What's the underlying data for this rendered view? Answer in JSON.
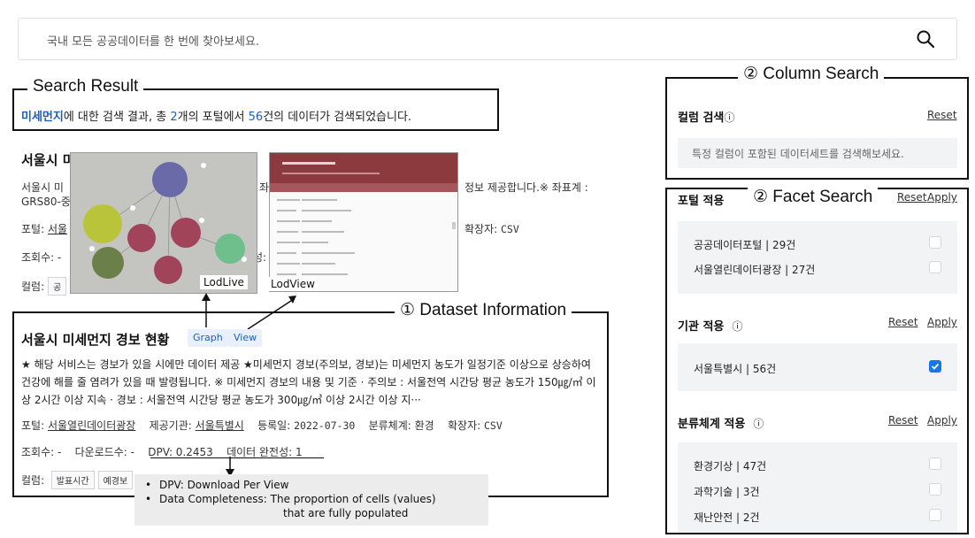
{
  "search": {
    "placeholder": "국내 모든 공공데이터를 한 번에 찾아보세요.",
    "icon": "search-icon"
  },
  "annotations": {
    "search_result": "Search Result",
    "column_search": "② Column Search",
    "facet_search": "② Facet Search",
    "dataset_information": "① Dataset Information",
    "lodlive": "LodLive",
    "lodview": "LodView",
    "tooltip": {
      "line1": "DPV: Download Per View",
      "line2a": "Data Completeness: The proportion of cells (values)",
      "line2b": "that are fully populated"
    }
  },
  "result_summary": {
    "keyword": "미세먼지",
    "part1": "에 대한 검색 결과, 총 ",
    "portal_count": "2",
    "part2": "개의 포털에서 ",
    "data_count": "56",
    "part3": "건의 데이터가 검색되었습니다."
  },
  "dataset1": {
    "title": "서울시 미",
    "desc_start": "서울시 미",
    "desc_start2": "GRS80-중",
    "desc_right": "좌",
    "desc_right2": "정보 제공합니다.※ 좌표계 :",
    "portal_label": "포털: ",
    "portal_value": "서울",
    "ext_label": "확장자: ",
    "ext_value": "CSV",
    "views_label": "조회수: -",
    "views_right": "성:",
    "columns_label": "컬럼:",
    "col_partial": "공"
  },
  "dataset2": {
    "title": "서울시 미세먼지 경보 현황",
    "tag_graph": "Graph",
    "tag_view": "View",
    "desc1": "★ 해당 서비스는 경보가 있을 시에만 데이터 제공 ★미세먼지 경보(주의보, 경보)는 미세먼지 농도가 일정기준 이상으로 상승하여",
    "desc2": "건강에 해를 줄 염려가 있을 때 발령됩니다. ※ 미세먼지 경보의 내용 및 기준 · 주의보 : 서울전역 시간당 평균 농도가 150㎍/㎥ 이",
    "desc3": "상 2시간 이상 지속 · 경보 : 서울전역 시간당 평균 농도가 300㎍/㎥ 이상 2시간 이상 지···",
    "portal_label": "포털: ",
    "portal_value": "서울열린데이터광장",
    "org_label": "제공기관: ",
    "org_value": "서울특별시",
    "date_label": "등록일: ",
    "date_value": "2022-07-30",
    "category_label": "분류체계: ",
    "category_value": "환경",
    "ext_label": "확장자: ",
    "ext_value": "CSV",
    "views": "조회수: -",
    "downloads": "다운로드수: -",
    "dpv": "DPV: 0.2453",
    "completeness": "데이터 완전성: 1",
    "columns_label": "컬럼:",
    "col1": "발표시간",
    "col2": "예경보"
  },
  "column_search": {
    "title": "컬럼 검색",
    "info": "ⓘ",
    "reset": "Reset",
    "placeholder": "특정 컬럼이 포함된 데이터세트를 검색해보세요."
  },
  "facets": {
    "portal": {
      "title": "포털 적용",
      "reset": "Reset",
      "apply": "Apply",
      "items": [
        {
          "label": "공공데이터포털 | 29건",
          "checked": false
        },
        {
          "label": "서울열린데이터광장 | 27건",
          "checked": false
        }
      ]
    },
    "org": {
      "title": "기관 적용",
      "info": "ⓘ",
      "reset": "Reset",
      "apply": "Apply",
      "items": [
        {
          "label": "서울특별시 | 56건",
          "checked": true
        }
      ]
    },
    "category": {
      "title": "분류체계 적용",
      "info": "ⓘ",
      "reset": "Reset",
      "apply": "Apply",
      "items": [
        {
          "label": "환경기상 | 47건",
          "checked": false
        },
        {
          "label": "과학기술 | 3건",
          "checked": false
        },
        {
          "label": "재난안전 | 2건",
          "checked": false
        }
      ]
    }
  },
  "colors": {
    "accent": "#1b5fc1",
    "checkbox": "#1976e8",
    "lodview_header": "#8c3a3e"
  }
}
